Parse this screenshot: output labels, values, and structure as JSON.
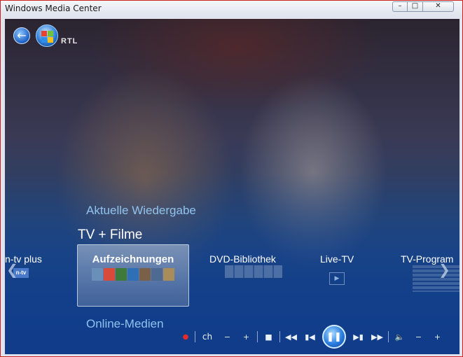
{
  "window": {
    "title": "Windows Media Center",
    "controls": {
      "minimize": "–",
      "maximize": "□",
      "close": "✕"
    }
  },
  "header": {
    "back_icon": "back-arrow-icon",
    "start_icon": "windows-orb-icon",
    "channel_logo": "RTL"
  },
  "menu": {
    "above": "Aktuelle Wiedergabe",
    "current": "TV + Filme",
    "below": "Online-Medien",
    "strip": {
      "left_partial": "n-tv plus",
      "left_logo": "n-tv",
      "focused": "Aufzeichnungen",
      "items": [
        "DVD-Bibliothek",
        "Live-TV",
        "TV-Program"
      ],
      "thumb_colors": [
        "#6a8fb8",
        "#d84a3a",
        "#3f7a3a",
        "#2f6fb5",
        "#7a6048",
        "#4e6a92",
        "#a88c5a"
      ]
    }
  },
  "transport": {
    "record": "●",
    "channel": "ch",
    "ch_minus": "−",
    "ch_plus": "+",
    "stop": "■",
    "rewind": "◀◀",
    "prev": "▮◀",
    "play_pause": "❚❚",
    "next": "▶▮",
    "fast_forward": "▶▶",
    "mute": "🔈",
    "vol_minus": "−",
    "vol_plus": "+"
  },
  "colors": {
    "accent": "#2b7fe0",
    "menu_text": "#8fc3ee",
    "record": "#e32b2b"
  }
}
